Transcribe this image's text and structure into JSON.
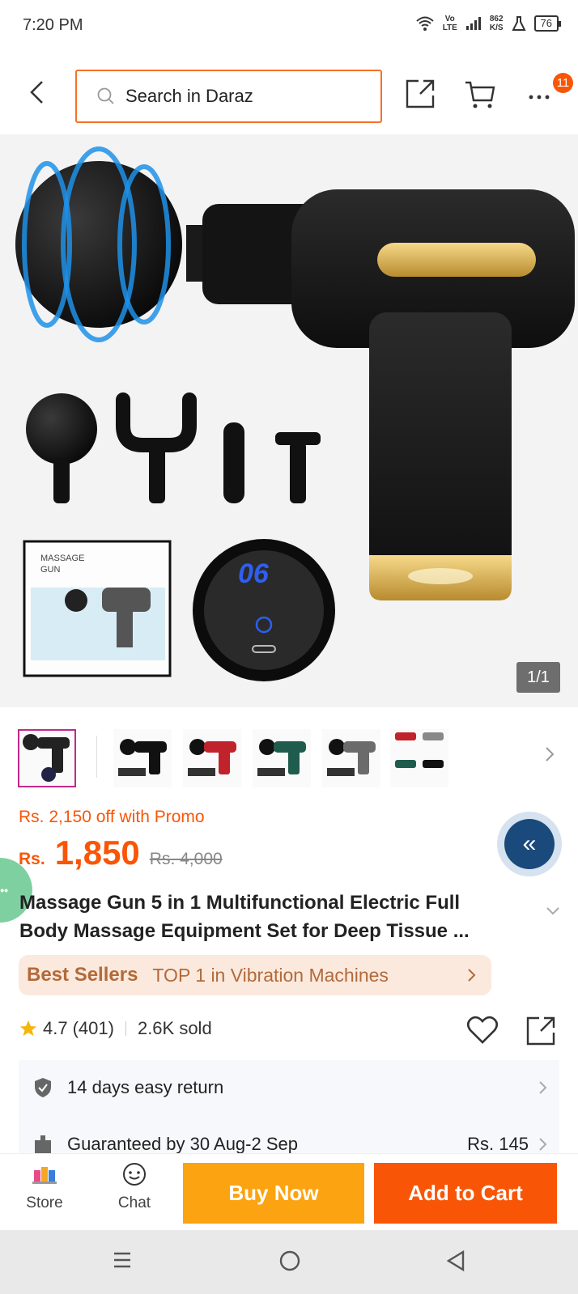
{
  "status_bar": {
    "time": "7:20 PM",
    "network_top": "Vo",
    "network_bottom": "LTE",
    "speed_top": "862",
    "speed_bottom": "K/S",
    "battery": "76"
  },
  "header": {
    "search_placeholder": "Search in Daraz",
    "more_badge": "11"
  },
  "gallery": {
    "counter": "1/1",
    "box_label_line1": "MASSAGE",
    "box_label_line2": "GUN",
    "display_value": "06",
    "thumbnails": [
      "black-set",
      "black",
      "red",
      "green",
      "grey",
      "multi-color"
    ]
  },
  "price": {
    "promo": "Rs. 2,150 off with Promo",
    "currency": "Rs.",
    "value": "1,850",
    "original": "Rs. 4,000"
  },
  "product": {
    "title_line1": "Massage Gun 5 in 1 Multifunctional Electric Full",
    "title_line2": "Body Massage Equipment Set for Deep Tissue ..."
  },
  "best_seller": {
    "logo": "Best Sellers",
    "text": "TOP 1 in Vibration Machines"
  },
  "rating": {
    "score": "4.7",
    "count": "(401)",
    "sold": "2.6K sold"
  },
  "services": {
    "return_label": "14 days easy return",
    "delivery_label": "Guaranteed by 30 Aug-2 Sep",
    "delivery_price": "Rs. 145"
  },
  "actions": {
    "store": "Store",
    "chat": "Chat",
    "buy_now": "Buy Now",
    "add_to_cart": "Add to Cart"
  },
  "colors": {
    "accent": "#f85606",
    "buy_now": "#fca311",
    "search_border": "#f57224"
  }
}
